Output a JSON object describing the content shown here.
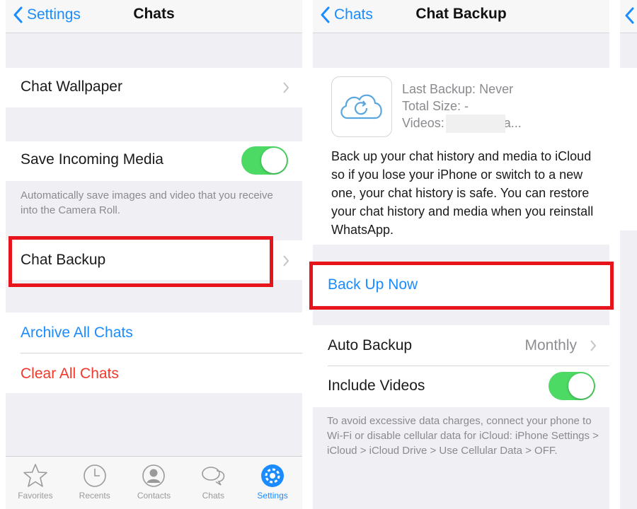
{
  "panel1": {
    "nav": {
      "back_label": "Settings",
      "title": "Chats"
    },
    "chat_wallpaper": "Chat Wallpaper",
    "save_incoming_media": "Save Incoming Media",
    "save_incoming_media_footer": "Automatically save images and video that you receive into the Camera Roll.",
    "chat_backup": "Chat Backup",
    "archive_all_chats": "Archive All Chats",
    "clear_all_chats": "Clear All Chats",
    "tabs": [
      {
        "label": "Favorites",
        "icon": "star-icon"
      },
      {
        "label": "Recents",
        "icon": "clock-icon"
      },
      {
        "label": "Contacts",
        "icon": "person-icon"
      },
      {
        "label": "Chats",
        "icon": "chat-bubbles-icon"
      },
      {
        "label": "Settings",
        "icon": "gear-icon"
      }
    ],
    "active_tab": "Settings"
  },
  "panel2": {
    "nav": {
      "back_label": "Chats",
      "title": "Chat Backup"
    },
    "last_backup": "Last Backup: Never",
    "total_size": "Total Size: -",
    "videos": "Videos:          to be uploa...",
    "description": "Back up your chat history and media to iCloud so if you lose your iPhone or switch to a new one, your chat history is safe. You can restore your chat history and media when you reinstall WhatsApp.",
    "back_up_now": "Back Up Now",
    "auto_backup_label": "Auto Backup",
    "auto_backup_value": "Monthly",
    "include_videos": "Include Videos",
    "footer": "To avoid excessive data charges, connect your phone to Wi-Fi or disable cellular data for iCloud: iPhone Settings > iCloud > iCloud Drive > Use Cellular Data > OFF."
  },
  "toggles": {
    "save_incoming_media": true,
    "include_videos": true
  },
  "colors": {
    "accent": "#1a8cff",
    "destructive": "#f0392b",
    "toggle_on": "#4cd964",
    "highlight": "#e8141b"
  }
}
